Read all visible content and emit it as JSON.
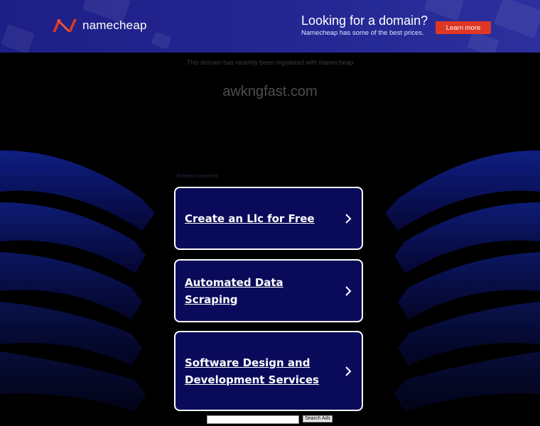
{
  "banner": {
    "brand_name": "namecheap",
    "promo_title": "Looking for a domain?",
    "promo_subtitle": "Namecheap has some of the best prices.",
    "cta_label": "Learn more",
    "colors": {
      "background": "#23248f",
      "logo": "#de3723",
      "cta": "#de3723"
    }
  },
  "page": {
    "registration_note": "This domain has recently been registered with Namecheap",
    "domain_name": "awkngfast.com",
    "relevant_searches_label": "Relevant searches"
  },
  "searches": [
    {
      "label": "Create an Llc for Free",
      "icon": "chevron-right-icon"
    },
    {
      "label": "Automated Data Scraping",
      "icon": "chevron-right-icon"
    },
    {
      "label": "Software Design and Development Services",
      "icon": "chevron-right-icon"
    }
  ],
  "search_bar": {
    "input_value": "",
    "button_label": "Search Ads"
  }
}
